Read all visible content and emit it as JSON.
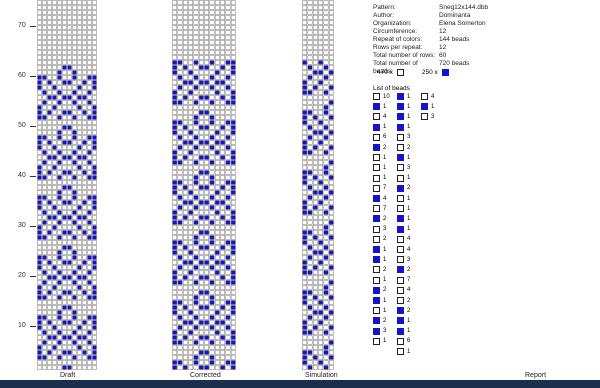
{
  "tabs": [
    "Draft",
    "Corrected",
    "Simulation",
    "Report"
  ],
  "y_ticks": [
    "70",
    "60",
    "50",
    "40",
    "30",
    "20",
    "10"
  ],
  "info": [
    {
      "k": "Pattern:",
      "v": "Sneg12x144.dbb"
    },
    {
      "k": "Author:",
      "v": "Dominanta"
    },
    {
      "k": "Organization:",
      "v": "Elena Somerton"
    },
    {
      "k": "Circumference:",
      "v": "12"
    },
    {
      "k": "Repeat of colors:",
      "v": "144 beads"
    },
    {
      "k": "Rows per repeat:",
      "v": "12"
    },
    {
      "k": "Total number of rows:",
      "v": "60"
    },
    {
      "k": "Total number of beads:",
      "v": "720 beads"
    }
  ],
  "counts": {
    "white": "470 x",
    "blue": "250 x"
  },
  "list_title": "List of beads",
  "colors": {
    "blue": "#1414c8"
  },
  "list_col1": [
    "10",
    "1",
    "4",
    "1",
    "6",
    "2",
    "1",
    "1",
    "1",
    "7",
    "4",
    "7",
    "2",
    "3",
    "2",
    "1",
    "1",
    "2",
    "1",
    "2",
    "1",
    "1",
    "2",
    "3",
    "1"
  ],
  "list_col1_color": [
    "w",
    "b",
    "w",
    "b",
    "w",
    "b",
    "w",
    "w",
    "w",
    "w",
    "b",
    "w",
    "b",
    "w",
    "w",
    "b",
    "b",
    "w",
    "w",
    "b",
    "b",
    "w",
    "b",
    "b",
    "w"
  ],
  "list_col2": [
    "1",
    "1",
    "1",
    "1",
    "3",
    "2",
    "1",
    "3",
    "1",
    "2",
    "1",
    "1",
    "1",
    "1",
    "4",
    "4",
    "3",
    "2",
    "7",
    "4",
    "2",
    "2",
    "1",
    "1",
    "6",
    "1"
  ],
  "list_col2_color": [
    "b",
    "b",
    "b",
    "b",
    "w",
    "w",
    "b",
    "w",
    "w",
    "b",
    "w",
    "w",
    "b",
    "b",
    "w",
    "w",
    "w",
    "b",
    "w",
    "w",
    "w",
    "b",
    "b",
    "b",
    "w",
    "w"
  ],
  "list_col3": [
    "4",
    "1",
    "3"
  ],
  "list_col3_color": [
    "w",
    "b",
    "w"
  ]
}
